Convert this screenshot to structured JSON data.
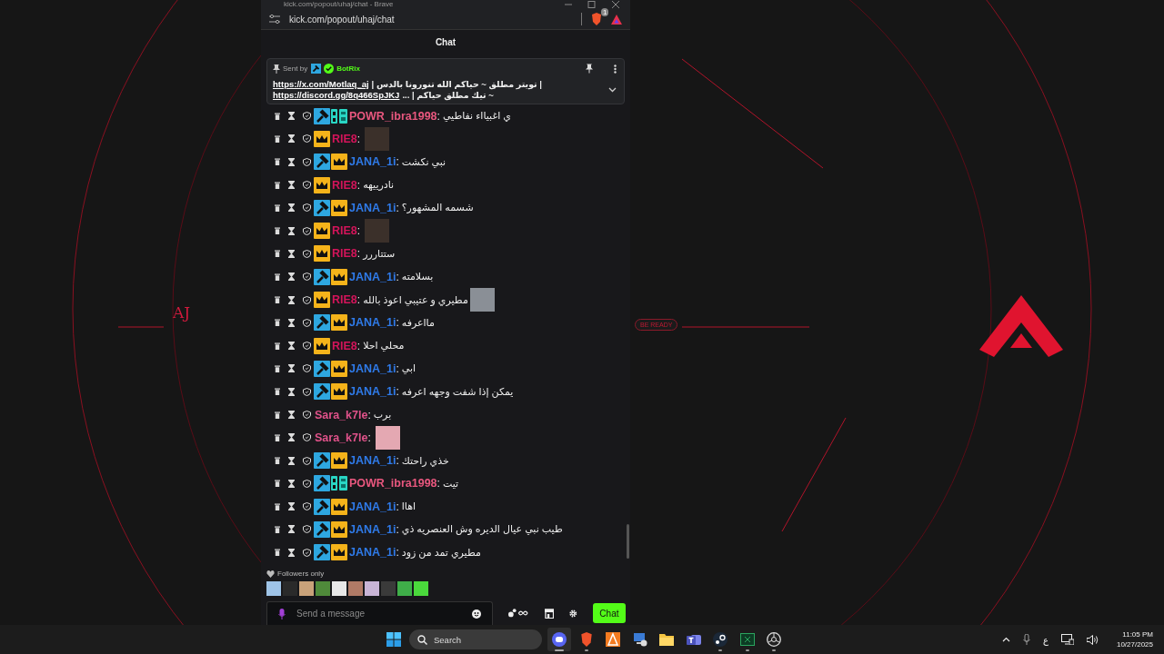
{
  "wallpaper": {
    "logo_text": "AJ",
    "tag": "BE READY"
  },
  "browser": {
    "title": "kick.com/popout/uhaj/chat - Brave",
    "url": "kick.com/popout/uhaj/chat",
    "shields_count": "1"
  },
  "chat": {
    "header": "Chat",
    "pinned": {
      "sent_by": "Sent by",
      "sender": "BotRix",
      "lines": [
        {
          "link": "https://x.com/Motlaq_aj",
          "text": "| تويتر مطلق ~ حياكم الله تنورونا بالدس |"
        },
        {
          "link": "https://discord.gg/8q466SpJKJ",
          "text": "~ تيك مطلق حياكم | ..."
        }
      ]
    },
    "messages": [
      {
        "badges": [
          {
            "kind": "mod"
          },
          {
            "kind": "og"
          }
        ],
        "user": "POWR_ibra1998",
        "color": "#e8577e",
        "colon": ":",
        "text": "ي اغبيااء نفاطيي",
        "emote": false
      },
      {
        "badges": [
          {
            "kind": "vip"
          }
        ],
        "user": "RIE8",
        "color": "#d4145a",
        "colon": ":",
        "emote": true
      },
      {
        "badges": [
          {
            "kind": "mod"
          },
          {
            "kind": "vip"
          }
        ],
        "user": "JANA_1i",
        "color": "#2f7bea",
        "colon": ":",
        "text": "نبي نكشت",
        "emote": false
      },
      {
        "badges": [
          {
            "kind": "vip"
          }
        ],
        "user": "RIE8",
        "color": "#d4145a",
        "colon": ":",
        "text": "نادرييهه",
        "emote": false
      },
      {
        "badges": [
          {
            "kind": "mod"
          },
          {
            "kind": "vip"
          }
        ],
        "user": "JANA_1i",
        "color": "#2f7bea",
        "colon": ":",
        "text": "شسمه المشهور؟",
        "emote": false
      },
      {
        "badges": [
          {
            "kind": "vip"
          }
        ],
        "user": "RIE8",
        "color": "#d4145a",
        "colon": ":",
        "emote": true
      },
      {
        "badges": [
          {
            "kind": "vip"
          }
        ],
        "user": "RIE8",
        "color": "#d4145a",
        "colon": ":",
        "text": "ستتاررر",
        "emote": false
      },
      {
        "badges": [
          {
            "kind": "mod"
          },
          {
            "kind": "vip"
          }
        ],
        "user": "JANA_1i",
        "color": "#2f7bea",
        "colon": ":",
        "text": "بسلامته",
        "emote": false
      },
      {
        "badges": [
          {
            "kind": "vip"
          }
        ],
        "user": "RIE8",
        "color": "#d4145a",
        "colon": ":",
        "text": "مطيري و عتيبي اعوذ بالله",
        "emote": true
      },
      {
        "badges": [
          {
            "kind": "mod"
          },
          {
            "kind": "vip"
          }
        ],
        "user": "JANA_1i",
        "color": "#2f7bea",
        "colon": ":",
        "text": "مااعرفه",
        "emote": false
      },
      {
        "badges": [
          {
            "kind": "vip"
          }
        ],
        "user": "RIE8",
        "color": "#d4145a",
        "colon": ":",
        "text": "محلي احلا",
        "emote": false
      },
      {
        "badges": [
          {
            "kind": "mod"
          },
          {
            "kind": "vip"
          }
        ],
        "user": "JANA_1i",
        "color": "#2f7bea",
        "colon": ":",
        "text": "ابي",
        "emote": false
      },
      {
        "badges": [
          {
            "kind": "mod"
          },
          {
            "kind": "vip"
          }
        ],
        "user": "JANA_1i",
        "color": "#2f7bea",
        "colon": ":",
        "text": "يمكن إذا شفت وجهه اعرفه",
        "emote": false
      },
      {
        "user": "Sara_k7le",
        "color": "#e0528a",
        "colon": ":",
        "text": "برب",
        "emote": false
      },
      {
        "user": "Sara_k7le",
        "color": "#e0528a",
        "colon": ":",
        "emote": true
      },
      {
        "badges": [
          {
            "kind": "mod"
          },
          {
            "kind": "vip"
          }
        ],
        "user": "JANA_1i",
        "color": "#2f7bea",
        "colon": ":",
        "text": "خذي راحتك",
        "emote": false
      },
      {
        "badges": [
          {
            "kind": "mod"
          },
          {
            "kind": "og"
          }
        ],
        "user": "POWR_ibra1998",
        "color": "#e8577e",
        "colon": ":",
        "text": "تيت",
        "emote": false
      },
      {
        "badges": [
          {
            "kind": "mod"
          },
          {
            "kind": "vip"
          }
        ],
        "user": "JANA_1i",
        "color": "#2f7bea",
        "colon": ":",
        "text": "اهاا",
        "emote": false
      },
      {
        "badges": [
          {
            "kind": "mod"
          },
          {
            "kind": "vip"
          }
        ],
        "user": "JANA_1i",
        "color": "#2f7bea",
        "colon": ":",
        "text": "طيب نبي عيال الديره وش العنصريه ذي",
        "emote": false
      },
      {
        "badges": [
          {
            "kind": "mod"
          },
          {
            "kind": "vip"
          }
        ],
        "user": "JANA_1i",
        "color": "#2f7bea",
        "colon": ":",
        "text": "مطيري تمد من زود",
        "emote": false
      }
    ],
    "followers_only": "Followers only",
    "input": {
      "placeholder": "Send a message"
    },
    "send_button": "Chat"
  },
  "taskbar": {
    "search_placeholder": "Search",
    "apps": [
      {
        "kind": "bubble",
        "running": true,
        "selected": true
      },
      {
        "kind": "lion",
        "running": true,
        "selected": false
      },
      {
        "kind": "cone",
        "running": false,
        "selected": false
      },
      {
        "kind": "computer",
        "running": false,
        "selected": false
      },
      {
        "kind": "folder",
        "running": false,
        "selected": false
      },
      {
        "kind": "team",
        "running": false,
        "selected": false
      },
      {
        "kind": "steam",
        "running": true,
        "selected": false
      },
      {
        "kind": "sheet",
        "running": true,
        "selected": false
      },
      {
        "kind": "aperture",
        "running": true,
        "selected": false
      }
    ],
    "language": "ع",
    "time": "11:05 PM",
    "date": "10/27/2025"
  }
}
